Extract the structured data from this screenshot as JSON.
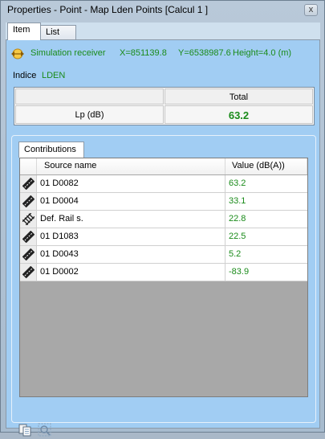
{
  "window": {
    "title": "Properties - Point - Map Lden Points [Calcul 1 ]",
    "close_label": "x"
  },
  "tabs": [
    {
      "label": "Item",
      "active": true
    },
    {
      "label": "List",
      "active": false
    }
  ],
  "receiver": {
    "icon": "receiver-icon",
    "name": "Simulation receiver",
    "x": "X=851139.8",
    "y": "Y=6538987.6",
    "height": "Height=4.0 (m)"
  },
  "indice": {
    "label": "Indice",
    "value": "LDEN"
  },
  "result_table": {
    "header_left": "",
    "header_right": "Total",
    "row_label": "Lp (dB)",
    "row_value": "63.2"
  },
  "contributions": {
    "tab_label": "Contributions",
    "columns": {
      "name": "Source name",
      "value": "Value (dB(A))"
    },
    "rows": [
      {
        "icon": "road-icon",
        "name": "01 D0082",
        "value": "63.2"
      },
      {
        "icon": "road-icon",
        "name": "01 D0004",
        "value": "33.1"
      },
      {
        "icon": "rail-icon",
        "name": "Def. Rail s.",
        "value": "22.8"
      },
      {
        "icon": "road-icon",
        "name": "01 D1083",
        "value": "22.5"
      },
      {
        "icon": "road-icon",
        "name": "01 D0043",
        "value": "5.2"
      },
      {
        "icon": "road-icon",
        "name": "01 D0002",
        "value": "-83.9"
      }
    ]
  },
  "tools": [
    {
      "icon": "copy-icon"
    },
    {
      "icon": "zoom-icon"
    }
  ],
  "colors": {
    "value_green": "#1a8b1a",
    "panel_blue": "#a1cdf3",
    "grid_empty": "#a8a8a8"
  }
}
